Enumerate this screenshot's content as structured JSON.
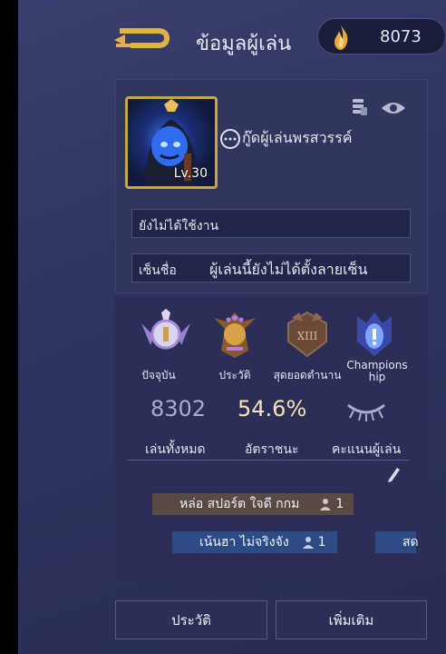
{
  "header": {
    "title": "ข้อมูลผู้เล่น",
    "currency_value": "8073"
  },
  "profile": {
    "level": "Lv.30",
    "rank_title": "กู๊ดผู้เล่นพรสวรรค์",
    "field_status": "ยังไม่ได้ใช้งาน",
    "signature_label": "เซ็นชื่อ",
    "signature_value": "ผู้เล่นนี้ยังไม่ได้ตั้งลายเซ็น"
  },
  "badges": [
    {
      "label": "ปัจจุบัน"
    },
    {
      "label": "ประวัติ"
    },
    {
      "label": "สุดยอดตำนาน",
      "emblem_text": "XIII"
    },
    {
      "label": "Champions\nhip"
    }
  ],
  "stats": {
    "matches_value": "8302",
    "matches_label": "เล่นทั้งหมด",
    "winrate_value": "54.6%",
    "winrate_label": "อัตราชนะ",
    "score_label": "คะแนนผู้เล่น"
  },
  "tags": [
    {
      "text": "หล่อ สปอร์ต ใจดี กกม",
      "count": "1"
    },
    {
      "text": "เน้นฮา ไม่จริงจัง",
      "count": "1"
    },
    {
      "text": "สด"
    }
  ],
  "buttons": {
    "history": "ประวัติ",
    "more": "เพิ่มเติม"
  },
  "colors": {
    "accent_gold": "#c9a24a",
    "winrate_color": "#f3e2b6",
    "stat_muted": "#a9adc9"
  }
}
